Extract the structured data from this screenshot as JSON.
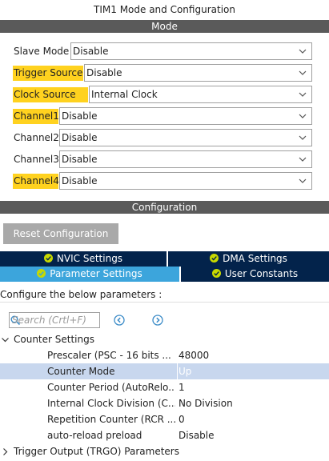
{
  "title": "TIM1 Mode and Configuration",
  "mode_header": "Mode",
  "mode_rows": [
    {
      "label": "Slave Mode",
      "value": "Disable",
      "highlighted": false
    },
    {
      "label": "Trigger Source",
      "value": "Disable",
      "highlighted": true
    },
    {
      "label": "Clock Source",
      "value": "Internal Clock",
      "highlighted": true
    },
    {
      "label": "Channel1",
      "value": "Disable",
      "highlighted": true
    },
    {
      "label": "Channel2",
      "value": "Disable",
      "highlighted": false
    },
    {
      "label": "Channel3",
      "value": "Disable",
      "highlighted": false
    },
    {
      "label": "Channel4",
      "value": "Disable",
      "highlighted": true
    }
  ],
  "config_header": "Configuration",
  "reset_button": "Reset Configuration",
  "tabs": {
    "nvic": "NVIC Settings",
    "dma": "DMA Settings",
    "parameter": "Parameter Settings",
    "user_constants": "User Constants"
  },
  "description": "Configure the below parameters :",
  "search": {
    "placeholder": "Search (Crtl+F)"
  },
  "tree": {
    "counter_settings": "Counter Settings",
    "params": [
      {
        "name": "Prescaler (PSC - 16 bits ...",
        "value": "48000"
      },
      {
        "name": "Counter Mode",
        "value": "Up"
      },
      {
        "name": "Counter Period (AutoRelo...",
        "value": "1"
      },
      {
        "name": "Internal Clock Division (C...",
        "value": "No Division"
      },
      {
        "name": "Repetition Counter (RCR ...",
        "value": "0"
      },
      {
        "name": "auto-reload preload",
        "value": "Disable"
      }
    ],
    "trigger_output": "Trigger Output (TRGO) Parameters"
  },
  "colors": {
    "highlight": "#ffd21f",
    "section_header": "#5a5a5a",
    "tab_dark": "#03234b",
    "tab_active": "#3ca5dc",
    "check_icon": "#c8d900",
    "selected_row": "#c8d7ee"
  }
}
